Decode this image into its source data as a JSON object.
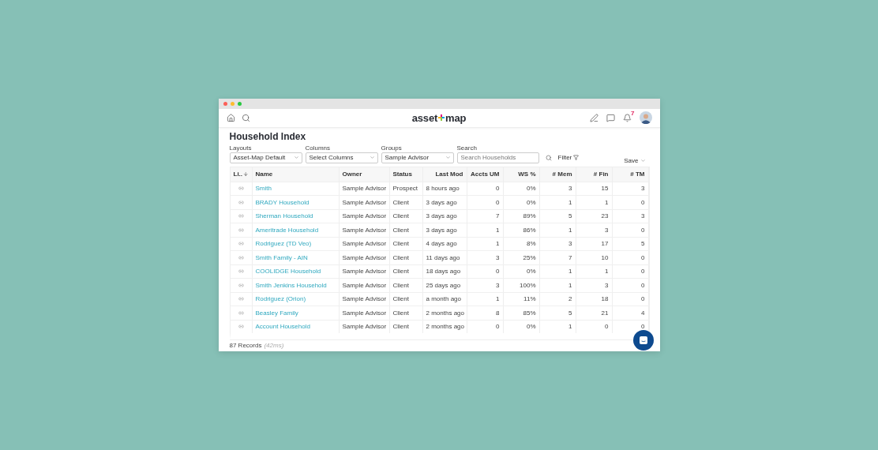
{
  "header": {
    "logo": [
      "asset",
      "map"
    ],
    "notification_count": "7"
  },
  "page": {
    "title": "Household Index"
  },
  "toolbar": {
    "selects": [
      {
        "label": "Layouts",
        "value": "Asset-Map Default"
      },
      {
        "label": "Columns",
        "value": "Select Columns"
      },
      {
        "label": "Groups",
        "value": "Sample Advisor"
      }
    ],
    "search": {
      "label": "Search",
      "placeholder": "Search Households"
    },
    "filter": "Filter",
    "save": "Save"
  },
  "table": {
    "columns": [
      {
        "label": "Li..",
        "sorted": true
      },
      {
        "label": "Name",
        "sorted": false
      },
      {
        "label": "Owner",
        "sorted": false
      },
      {
        "label": "Status",
        "sorted": false
      },
      {
        "label": "Last Mod",
        "sorted": false
      },
      {
        "label": "Accts UM",
        "sorted": false
      },
      {
        "label": "WS %",
        "sorted": false
      },
      {
        "label": "# Mem",
        "sorted": false
      },
      {
        "label": "# Fin",
        "sorted": false
      },
      {
        "label": "# TM",
        "sorted": false
      }
    ],
    "rows": [
      {
        "name": "Smith",
        "owner": "Sample Advisor",
        "status": "Prospect",
        "last_mod": "8 hours ago",
        "accts_um": "0",
        "ws": "0%",
        "mem": "3",
        "fin": "15",
        "tm": "3"
      },
      {
        "name": "BRADY Household",
        "owner": "Sample Advisor",
        "status": "Client",
        "last_mod": "3 days ago",
        "accts_um": "0",
        "ws": "0%",
        "mem": "1",
        "fin": "1",
        "tm": "0"
      },
      {
        "name": "Sherman Household",
        "owner": "Sample Advisor",
        "status": "Client",
        "last_mod": "3 days ago",
        "accts_um": "7",
        "ws": "89%",
        "mem": "5",
        "fin": "23",
        "tm": "3"
      },
      {
        "name": "Ameritrade Household",
        "owner": "Sample Advisor",
        "status": "Client",
        "last_mod": "3 days ago",
        "accts_um": "1",
        "ws": "86%",
        "mem": "1",
        "fin": "3",
        "tm": "0"
      },
      {
        "name": "Rodriguez (TD Veo)",
        "owner": "Sample Advisor",
        "status": "Client",
        "last_mod": "4 days ago",
        "accts_um": "1",
        "ws": "8%",
        "mem": "3",
        "fin": "17",
        "tm": "5"
      },
      {
        "name": "Smith Family - AIN",
        "owner": "Sample Advisor",
        "status": "Client",
        "last_mod": "11 days ago",
        "accts_um": "3",
        "ws": "25%",
        "mem": "7",
        "fin": "10",
        "tm": "0"
      },
      {
        "name": "COOLIDGE Household",
        "owner": "Sample Advisor",
        "status": "Client",
        "last_mod": "18 days ago",
        "accts_um": "0",
        "ws": "0%",
        "mem": "1",
        "fin": "1",
        "tm": "0"
      },
      {
        "name": "Smith Jenkins Household",
        "owner": "Sample Advisor",
        "status": "Client",
        "last_mod": "25 days ago",
        "accts_um": "3",
        "ws": "100%",
        "mem": "1",
        "fin": "3",
        "tm": "0"
      },
      {
        "name": "Rodriguez (Orion)",
        "owner": "Sample Advisor",
        "status": "Client",
        "last_mod": "a month ago",
        "accts_um": "1",
        "ws": "11%",
        "mem": "2",
        "fin": "18",
        "tm": "0"
      },
      {
        "name": "Beasley Family",
        "owner": "Sample Advisor",
        "status": "Client",
        "last_mod": "2 months ago",
        "accts_um": "8",
        "ws": "85%",
        "mem": "5",
        "fin": "21",
        "tm": "4"
      },
      {
        "name": "Account Household",
        "owner": "Sample Advisor",
        "status": "Client",
        "last_mod": "2 months ago",
        "accts_um": "0",
        "ws": "0%",
        "mem": "1",
        "fin": "0",
        "tm": "0"
      }
    ]
  },
  "footer": {
    "count": "87 Records",
    "timing": "(42ms)"
  }
}
